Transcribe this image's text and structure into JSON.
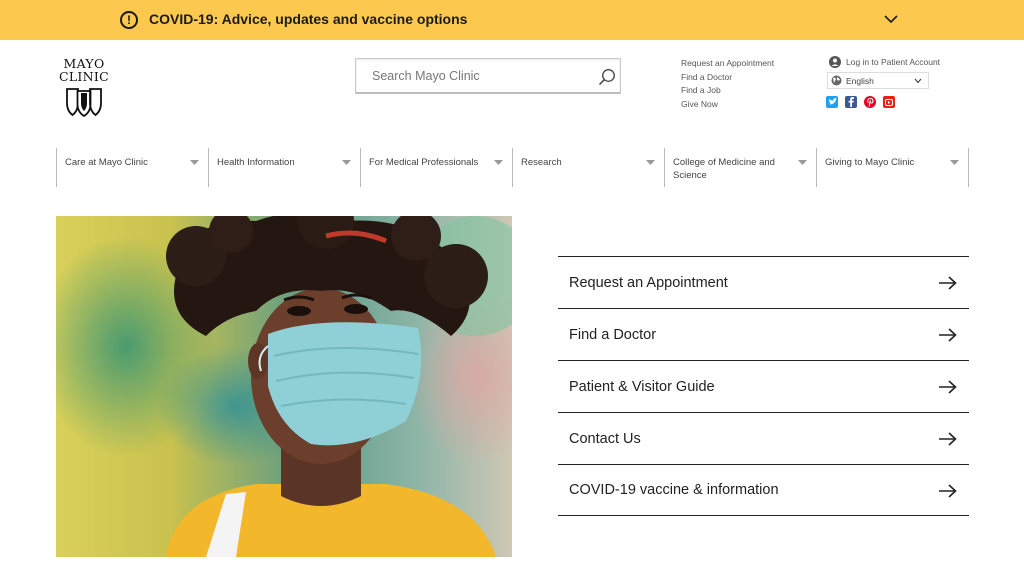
{
  "alert": {
    "text": "COVID-19: Advice, updates and vaccine options",
    "icon": "exclamation-circle-icon"
  },
  "logo": {
    "line1": "MAYO",
    "line2": "CLINIC"
  },
  "search": {
    "placeholder": "Search Mayo Clinic"
  },
  "utility_links": [
    "Request an Appointment",
    "Find a Doctor",
    "Find a Job",
    "Give Now"
  ],
  "account": {
    "login_label": "Log in to Patient Account",
    "language": "English"
  },
  "social": [
    "twitter-icon",
    "facebook-icon",
    "pinterest-icon",
    "youtube-icon"
  ],
  "nav": [
    "Care at Mayo Clinic",
    "Health Information",
    "For Medical Professionals",
    "Research",
    "College of Medicine and Science",
    "Giving to Mayo Clinic"
  ],
  "quick_links": [
    "Request an Appointment",
    "Find a Doctor",
    "Patient & Visitor Guide",
    "Contact Us",
    "COVID-19 vaccine & information"
  ],
  "colors": {
    "alert_bg": "#fcc94e",
    "text": "#222222"
  }
}
